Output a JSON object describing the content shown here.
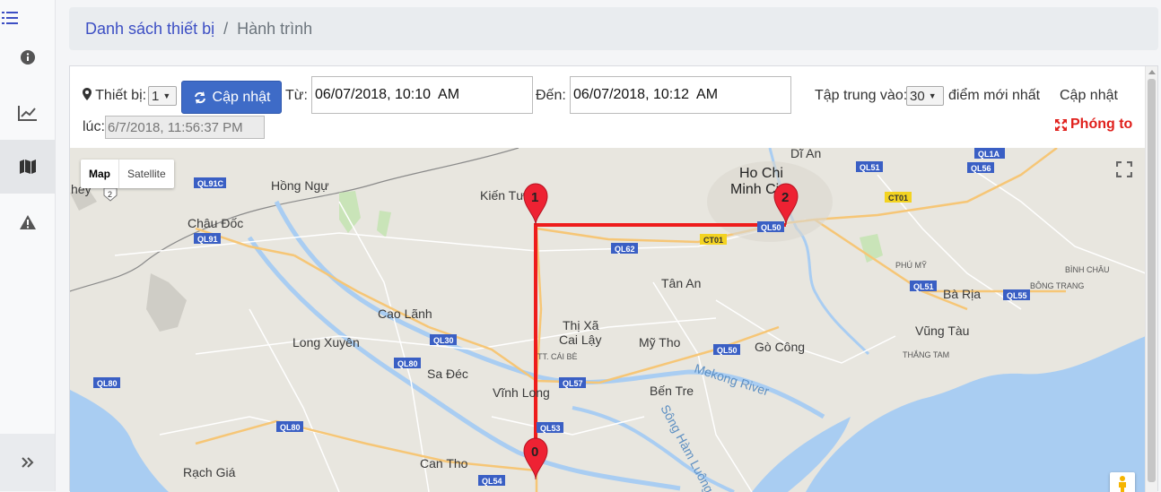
{
  "breadcrumb": {
    "parent": "Danh sách thiết bị",
    "separator": "/",
    "current": "Hành trình"
  },
  "toolbar": {
    "device_label": "Thiết bị:",
    "device_value": "1",
    "update_button": "Cập nhật",
    "from_label": "Từ:",
    "from_value": "06/07/2018, 10:10  AM",
    "to_label": "Đến:",
    "to_value": "06/07/2018, 10:12  AM",
    "focus_label": "Tập trung vào:",
    "focus_value": "30",
    "latest_label": "điểm mới nhất",
    "updated_label": "Cập nhật",
    "at_label": "lúc:",
    "updated_value": "6/7/2018, 11:56:37 PM",
    "zoom_label": "Phóng to"
  },
  "map": {
    "type_map": "Map",
    "type_satellite": "Satellite",
    "markers": [
      "0",
      "1",
      "2"
    ],
    "route_color": "#ee1c1c",
    "places": {
      "hochi1": "Ho Chi",
      "hochi2": "Minh Ci",
      "dian": "Dĩ An",
      "hongngu": "Hồng Ngự",
      "kientuong": "Kiến Tườ",
      "chaudoc": "Châu Đốc",
      "hey": "hey",
      "tanan": "Tân An",
      "caolanh": "Cao Lãnh",
      "longxuyen": "Long Xuyên",
      "thixa": "Thị Xã",
      "cailay": "Cai Lậy",
      "mytho": "Mỹ Tho",
      "gocong": "Gò Công",
      "sadec": "Sa Đéc",
      "vinhlong": "Vĩnh Long",
      "bentre": "Bến Tre",
      "cantho": "Can Tho",
      "rachgia": "Rạch Giá",
      "bari": "Bà Rịa",
      "vungtau": "Vũng Tàu",
      "thangtam": "THẮNG TAM",
      "phumy": "PHÚ MỸ",
      "binhchau": "BÌNH CHÂU",
      "bongtrang": "BÔNG TRANG",
      "ttcaibe": "TT. CÁI BÈ",
      "mekong": "Mekong River",
      "songham": "Sông Hàm Luông"
    },
    "roads": {
      "ql91c": "QL91C",
      "ql91": "QL91",
      "ql62": "QL62",
      "ql30": "QL30",
      "ql80a": "QL80",
      "ql80b": "QL80",
      "ql80c": "QL80",
      "ql57": "QL57",
      "ql50": "QL50",
      "ql53": "QL53",
      "ql54": "QL54",
      "ql51a": "QL51",
      "ql51b": "QL51",
      "ql56": "QL56",
      "ql1a": "QL1A",
      "ql55": "QL55",
      "ql50b": "QL50",
      "ct01a": "CT01",
      "ct01b": "CT01",
      "shield2": "2"
    }
  }
}
